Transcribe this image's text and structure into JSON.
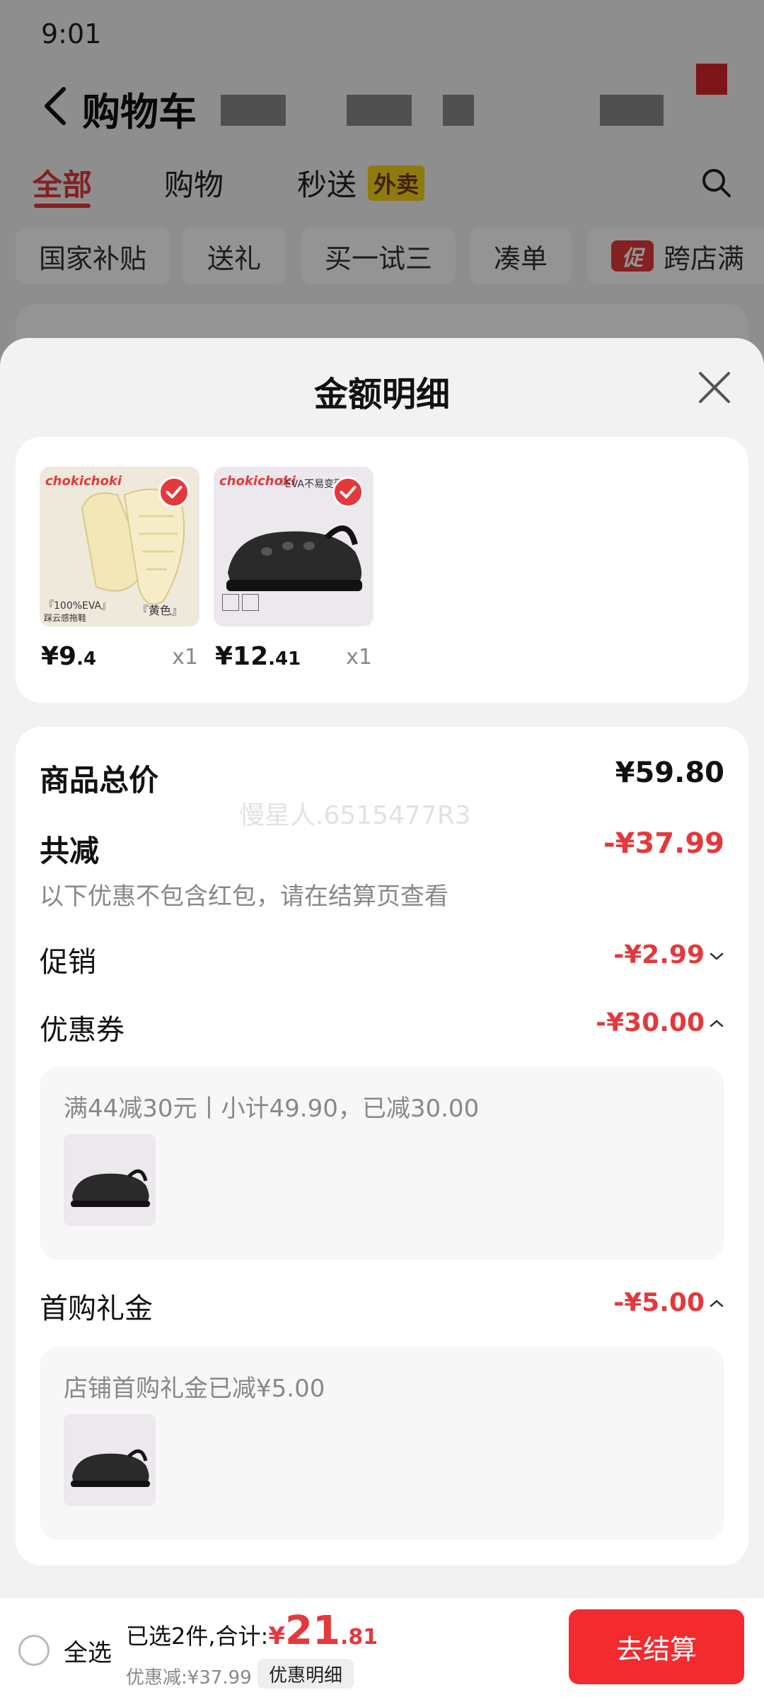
{
  "status_bar": {
    "time": "9:01"
  },
  "header": {
    "title": "购物车"
  },
  "tabs": [
    {
      "label": "全部"
    },
    {
      "label": "购物"
    },
    {
      "label": "秒送",
      "badge": "外卖"
    }
  ],
  "chips": [
    {
      "label": "国家补贴"
    },
    {
      "label": "送礼"
    },
    {
      "label": "买一试三"
    },
    {
      "label": "凑单"
    },
    {
      "label": "跨店满",
      "promo_icon": "促"
    }
  ],
  "sheet": {
    "title": "金额明细",
    "products": [
      {
        "brand": "chokichoki",
        "caption_left": "『100%EVA』",
        "caption_left2": "踩云感拖鞋",
        "caption_right": "『黄色』",
        "price_int": "¥9",
        "price_dec": ".4",
        "qty": "x1",
        "icon": "yellow-slide-sandal"
      },
      {
        "brand": "chokichoki",
        "caption_left": "『EVA不易变形』",
        "caption_left2": "",
        "caption_right": "",
        "price_int": "¥12",
        "price_dec": ".41",
        "qty": "x1",
        "icon": "black-clog"
      }
    ],
    "summary": {
      "total_label": "商品总价",
      "total_value": "¥59.80",
      "watermark": "慢星人.6515477R3",
      "reduce_label": "共减",
      "reduce_value": "-¥37.99",
      "reduce_note": "以下优惠不包含红包，请在结算页查看",
      "promo_label": "促销",
      "promo_value": "-¥2.99",
      "coupon_label": "优惠券",
      "coupon_value": "-¥30.00",
      "coupon_detail": "满44减30元丨小计49.90，已减30.00",
      "gift_label": "首购礼金",
      "gift_value": "-¥5.00",
      "gift_detail": "店铺首购礼金已减¥5.00"
    }
  },
  "footer": {
    "select_all": "全选",
    "selected_text": "已选2件,合计:",
    "currency": "¥",
    "total_int": "21",
    "total_dec": ".81",
    "discount_text": "优惠减:¥37.99",
    "detail_tag": "优惠明细",
    "checkout": "去结算"
  },
  "colors": {
    "accent_red": "#e4393c",
    "checkout_red": "#f22b2f",
    "badge_yellow": "#f7d21b"
  }
}
